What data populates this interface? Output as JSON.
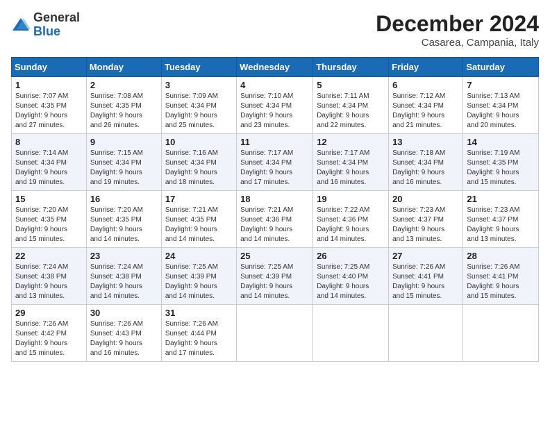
{
  "logo": {
    "general": "General",
    "blue": "Blue"
  },
  "title": "December 2024",
  "subtitle": "Casarea, Campania, Italy",
  "weekdays": [
    "Sunday",
    "Monday",
    "Tuesday",
    "Wednesday",
    "Thursday",
    "Friday",
    "Saturday"
  ],
  "weeks": [
    [
      {
        "day": "1",
        "info": "Sunrise: 7:07 AM\nSunset: 4:35 PM\nDaylight: 9 hours\nand 27 minutes."
      },
      {
        "day": "2",
        "info": "Sunrise: 7:08 AM\nSunset: 4:35 PM\nDaylight: 9 hours\nand 26 minutes."
      },
      {
        "day": "3",
        "info": "Sunrise: 7:09 AM\nSunset: 4:34 PM\nDaylight: 9 hours\nand 25 minutes."
      },
      {
        "day": "4",
        "info": "Sunrise: 7:10 AM\nSunset: 4:34 PM\nDaylight: 9 hours\nand 23 minutes."
      },
      {
        "day": "5",
        "info": "Sunrise: 7:11 AM\nSunset: 4:34 PM\nDaylight: 9 hours\nand 22 minutes."
      },
      {
        "day": "6",
        "info": "Sunrise: 7:12 AM\nSunset: 4:34 PM\nDaylight: 9 hours\nand 21 minutes."
      },
      {
        "day": "7",
        "info": "Sunrise: 7:13 AM\nSunset: 4:34 PM\nDaylight: 9 hours\nand 20 minutes."
      }
    ],
    [
      {
        "day": "8",
        "info": "Sunrise: 7:14 AM\nSunset: 4:34 PM\nDaylight: 9 hours\nand 19 minutes."
      },
      {
        "day": "9",
        "info": "Sunrise: 7:15 AM\nSunset: 4:34 PM\nDaylight: 9 hours\nand 19 minutes."
      },
      {
        "day": "10",
        "info": "Sunrise: 7:16 AM\nSunset: 4:34 PM\nDaylight: 9 hours\nand 18 minutes."
      },
      {
        "day": "11",
        "info": "Sunrise: 7:17 AM\nSunset: 4:34 PM\nDaylight: 9 hours\nand 17 minutes."
      },
      {
        "day": "12",
        "info": "Sunrise: 7:17 AM\nSunset: 4:34 PM\nDaylight: 9 hours\nand 16 minutes."
      },
      {
        "day": "13",
        "info": "Sunrise: 7:18 AM\nSunset: 4:34 PM\nDaylight: 9 hours\nand 16 minutes."
      },
      {
        "day": "14",
        "info": "Sunrise: 7:19 AM\nSunset: 4:35 PM\nDaylight: 9 hours\nand 15 minutes."
      }
    ],
    [
      {
        "day": "15",
        "info": "Sunrise: 7:20 AM\nSunset: 4:35 PM\nDaylight: 9 hours\nand 15 minutes."
      },
      {
        "day": "16",
        "info": "Sunrise: 7:20 AM\nSunset: 4:35 PM\nDaylight: 9 hours\nand 14 minutes."
      },
      {
        "day": "17",
        "info": "Sunrise: 7:21 AM\nSunset: 4:35 PM\nDaylight: 9 hours\nand 14 minutes."
      },
      {
        "day": "18",
        "info": "Sunrise: 7:21 AM\nSunset: 4:36 PM\nDaylight: 9 hours\nand 14 minutes."
      },
      {
        "day": "19",
        "info": "Sunrise: 7:22 AM\nSunset: 4:36 PM\nDaylight: 9 hours\nand 14 minutes."
      },
      {
        "day": "20",
        "info": "Sunrise: 7:23 AM\nSunset: 4:37 PM\nDaylight: 9 hours\nand 13 minutes."
      },
      {
        "day": "21",
        "info": "Sunrise: 7:23 AM\nSunset: 4:37 PM\nDaylight: 9 hours\nand 13 minutes."
      }
    ],
    [
      {
        "day": "22",
        "info": "Sunrise: 7:24 AM\nSunset: 4:38 PM\nDaylight: 9 hours\nand 13 minutes."
      },
      {
        "day": "23",
        "info": "Sunrise: 7:24 AM\nSunset: 4:38 PM\nDaylight: 9 hours\nand 14 minutes."
      },
      {
        "day": "24",
        "info": "Sunrise: 7:25 AM\nSunset: 4:39 PM\nDaylight: 9 hours\nand 14 minutes."
      },
      {
        "day": "25",
        "info": "Sunrise: 7:25 AM\nSunset: 4:39 PM\nDaylight: 9 hours\nand 14 minutes."
      },
      {
        "day": "26",
        "info": "Sunrise: 7:25 AM\nSunset: 4:40 PM\nDaylight: 9 hours\nand 14 minutes."
      },
      {
        "day": "27",
        "info": "Sunrise: 7:26 AM\nSunset: 4:41 PM\nDaylight: 9 hours\nand 15 minutes."
      },
      {
        "day": "28",
        "info": "Sunrise: 7:26 AM\nSunset: 4:41 PM\nDaylight: 9 hours\nand 15 minutes."
      }
    ],
    [
      {
        "day": "29",
        "info": "Sunrise: 7:26 AM\nSunset: 4:42 PM\nDaylight: 9 hours\nand 15 minutes."
      },
      {
        "day": "30",
        "info": "Sunrise: 7:26 AM\nSunset: 4:43 PM\nDaylight: 9 hours\nand 16 minutes."
      },
      {
        "day": "31",
        "info": "Sunrise: 7:26 AM\nSunset: 4:44 PM\nDaylight: 9 hours\nand 17 minutes."
      },
      null,
      null,
      null,
      null
    ]
  ]
}
